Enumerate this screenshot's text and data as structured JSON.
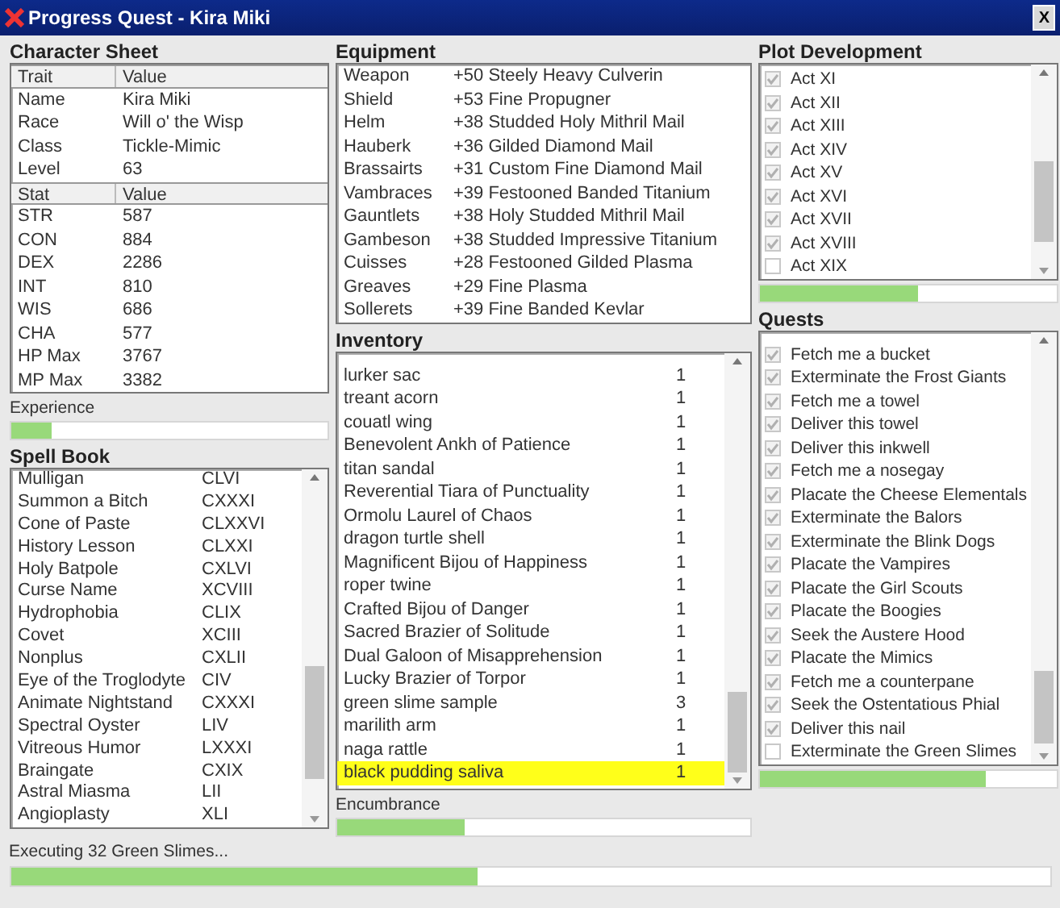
{
  "window": {
    "title": "Progress Quest - Kira Miki",
    "close_label": "X"
  },
  "character_sheet": {
    "title": "Character Sheet",
    "trait_columns": [
      "Trait",
      "Value"
    ],
    "traits": [
      {
        "trait": "Name",
        "value": "Kira Miki"
      },
      {
        "trait": "Race",
        "value": "Will o' the Wisp"
      },
      {
        "trait": "Class",
        "value": "Tickle-Mimic"
      },
      {
        "trait": "Level",
        "value": "63"
      }
    ],
    "stat_columns": [
      "Stat",
      "Value"
    ],
    "stats": [
      {
        "stat": "STR",
        "value": "587"
      },
      {
        "stat": "CON",
        "value": "884"
      },
      {
        "stat": "DEX",
        "value": "2286"
      },
      {
        "stat": "INT",
        "value": "810"
      },
      {
        "stat": "WIS",
        "value": "686"
      },
      {
        "stat": "CHA",
        "value": "577"
      },
      {
        "stat": "HP Max",
        "value": "3767"
      },
      {
        "stat": "MP Max",
        "value": "3382"
      }
    ]
  },
  "experience": {
    "label": "Experience",
    "level": 0.13
  },
  "spell_book": {
    "title": "Spell Book",
    "spells": [
      {
        "name": "Mulligan",
        "rank": "CLVI"
      },
      {
        "name": "Summon a Bitch",
        "rank": "CXXXI"
      },
      {
        "name": "Cone of Paste",
        "rank": "CLXXVI"
      },
      {
        "name": "History Lesson",
        "rank": "CLXXI"
      },
      {
        "name": "Holy Batpole",
        "rank": "CXLVI"
      },
      {
        "name": "Curse Name",
        "rank": "XCVIII"
      },
      {
        "name": "Hydrophobia",
        "rank": "CLIX"
      },
      {
        "name": "Covet",
        "rank": "XCIII"
      },
      {
        "name": "Nonplus",
        "rank": "CXLII"
      },
      {
        "name": "Eye of the Troglodyte",
        "rank": "CIV"
      },
      {
        "name": "Animate Nightstand",
        "rank": "CXXXI"
      },
      {
        "name": "Spectral Oyster",
        "rank": "LIV"
      },
      {
        "name": "Vitreous Humor",
        "rank": "LXXXI"
      },
      {
        "name": "Braingate",
        "rank": "CXIX"
      },
      {
        "name": "Astral Miasma",
        "rank": "LII"
      },
      {
        "name": "Angioplasty",
        "rank": "XLI"
      }
    ]
  },
  "equipment": {
    "title": "Equipment",
    "items": [
      {
        "slot": "Weapon",
        "name": "+50 Steely Heavy Culverin"
      },
      {
        "slot": "Shield",
        "name": "+53 Fine Propugner"
      },
      {
        "slot": "Helm",
        "name": "+38 Studded Holy Mithril Mail"
      },
      {
        "slot": "Hauberk",
        "name": "+36 Gilded Diamond Mail"
      },
      {
        "slot": "Brassairts",
        "name": "+31 Custom Fine Diamond Mail"
      },
      {
        "slot": "Vambraces",
        "name": "+39 Festooned Banded Titanium"
      },
      {
        "slot": "Gauntlets",
        "name": "+38 Holy Studded Mithril Mail"
      },
      {
        "slot": "Gambeson",
        "name": "+38 Studded Impressive Titanium"
      },
      {
        "slot": "Cuisses",
        "name": "+28 Festooned Gilded Plasma"
      },
      {
        "slot": "Greaves",
        "name": "+29 Fine Plasma"
      },
      {
        "slot": "Sollerets",
        "name": "+39 Fine Banded Kevlar"
      }
    ]
  },
  "inventory": {
    "title": "Inventory",
    "items": [
      {
        "name": "lurker sac",
        "quantity": "1",
        "selected": false
      },
      {
        "name": "treant acorn",
        "quantity": "1",
        "selected": false
      },
      {
        "name": "couatl wing",
        "quantity": "1",
        "selected": false
      },
      {
        "name": "Benevolent Ankh of Patience",
        "quantity": "1",
        "selected": false
      },
      {
        "name": "titan sandal",
        "quantity": "1",
        "selected": false
      },
      {
        "name": "Reverential Tiara of Punctuality",
        "quantity": "1",
        "selected": false
      },
      {
        "name": "Ormolu Laurel of Chaos",
        "quantity": "1",
        "selected": false
      },
      {
        "name": "dragon turtle shell",
        "quantity": "1",
        "selected": false
      },
      {
        "name": "Magnificent Bijou of Happiness",
        "quantity": "1",
        "selected": false
      },
      {
        "name": "roper twine",
        "quantity": "1",
        "selected": false
      },
      {
        "name": "Crafted Bijou of Danger",
        "quantity": "1",
        "selected": false
      },
      {
        "name": "Sacred Brazier of Solitude",
        "quantity": "1",
        "selected": false
      },
      {
        "name": "Dual Galoon of Misapprehension",
        "quantity": "1",
        "selected": false
      },
      {
        "name": "Lucky Brazier of Torpor",
        "quantity": "1",
        "selected": false
      },
      {
        "name": "green slime sample",
        "quantity": "3",
        "selected": false
      },
      {
        "name": "marilith arm",
        "quantity": "1",
        "selected": false
      },
      {
        "name": "naga rattle",
        "quantity": "1",
        "selected": false
      },
      {
        "name": "black pudding saliva",
        "quantity": "1",
        "selected": true
      }
    ]
  },
  "encumbrance": {
    "label": "Encumbrance",
    "level": 0.31
  },
  "plot_development": {
    "title": "Plot Development",
    "acts": [
      {
        "name": "Act XI",
        "checked": true
      },
      {
        "name": "Act XII",
        "checked": true
      },
      {
        "name": "Act XIII",
        "checked": true
      },
      {
        "name": "Act XIV",
        "checked": true
      },
      {
        "name": "Act XV",
        "checked": true
      },
      {
        "name": "Act XVI",
        "checked": true
      },
      {
        "name": "Act XVII",
        "checked": true
      },
      {
        "name": "Act XVIII",
        "checked": true
      },
      {
        "name": "Act XIX",
        "checked": false
      }
    ],
    "level": 0.53
  },
  "quests": {
    "title": "Quests",
    "items": [
      {
        "name": "Fetch me a bucket",
        "checked": true
      },
      {
        "name": "Exterminate the Frost Giants",
        "checked": true
      },
      {
        "name": "Fetch me a towel",
        "checked": true
      },
      {
        "name": "Deliver this towel",
        "checked": true
      },
      {
        "name": "Deliver this inkwell",
        "checked": true
      },
      {
        "name": "Fetch me a nosegay",
        "checked": true
      },
      {
        "name": "Placate the Cheese Elementals",
        "checked": true
      },
      {
        "name": "Exterminate the Balors",
        "checked": true
      },
      {
        "name": "Exterminate the Blink Dogs",
        "checked": true
      },
      {
        "name": "Placate the Vampires",
        "checked": true
      },
      {
        "name": "Placate the Girl Scouts",
        "checked": true
      },
      {
        "name": "Placate the Boogies",
        "checked": true
      },
      {
        "name": "Seek the Austere Hood",
        "checked": true
      },
      {
        "name": "Placate the Mimics",
        "checked": true
      },
      {
        "name": "Fetch me a counterpane",
        "checked": true
      },
      {
        "name": "Seek the Ostentatious Phial",
        "checked": true
      },
      {
        "name": "Deliver this nail",
        "checked": true
      },
      {
        "name": "Exterminate the Green Slimes",
        "checked": false
      }
    ],
    "level": 0.76
  },
  "status_bar": {
    "text": "Executing 32 Green Slimes...",
    "level": 0.45
  }
}
